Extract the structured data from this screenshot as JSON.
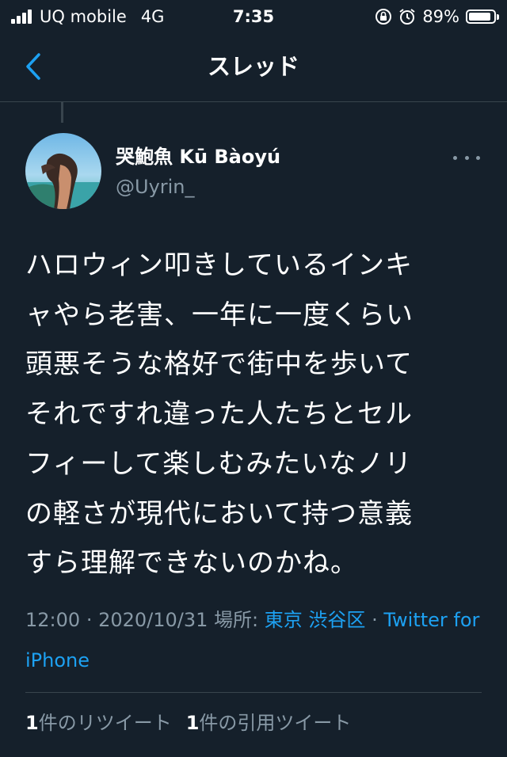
{
  "status_bar": {
    "carrier": "UQ mobile",
    "network": "4G",
    "time": "7:35",
    "battery": "89%",
    "battery_level": 0.89
  },
  "nav": {
    "title": "スレッド",
    "back_icon": "chevron-left-icon"
  },
  "tweet": {
    "display_name": "哭鮑魚 Kū Bàoyú",
    "handle": "@Uyrin_",
    "text": "ハロウィン叩きしているインキ\nャやら老害、一年に一度くらい\n頭悪そうな格好で街中を歩いて\nそれですれ違った人たちとセル\nフィーして楽しむみたいなノリ\nの軽さが現代において持つ意義\nすら理解できないのかね。",
    "time": "12:00",
    "date": "2020/10/31",
    "location_label": "場所:",
    "location": "東京 渋谷区",
    "client": "Twitter for iPhone",
    "separator": "·"
  },
  "stats": {
    "retweets_count": "1",
    "retweets_label": "件のリツイート",
    "quotes_count": "1",
    "quotes_label": "件の引用ツイート"
  },
  "colors": {
    "background": "#15202b",
    "accent": "#1da1f2",
    "secondary_text": "#8899a6",
    "border": "#38444d"
  }
}
